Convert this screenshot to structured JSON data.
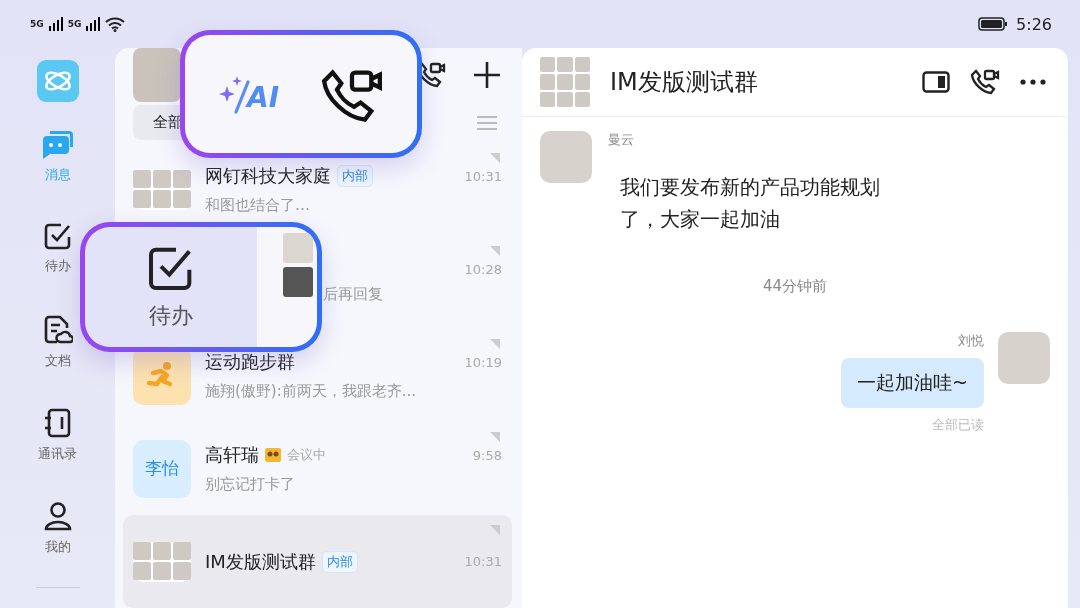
{
  "status_bar": {
    "network_1": "5G",
    "network_2": "5G",
    "time": "5:26"
  },
  "nav": {
    "items": [
      {
        "label": "消息",
        "selected": true
      },
      {
        "label": "待办",
        "selected": false
      },
      {
        "label": "文档",
        "selected": false
      },
      {
        "label": "通讯录",
        "selected": false
      },
      {
        "label": "我的",
        "selected": false
      }
    ]
  },
  "filter": {
    "label": "全部"
  },
  "conversations": [
    {
      "kind": "group",
      "name": "网钉科技大家庭",
      "tag": "内部",
      "time": "10:31",
      "preview": "和图也结合了…",
      "selected": false
    },
    {
      "kind": "covered",
      "time": "10:28",
      "preview": "后再回复",
      "selected": false
    },
    {
      "kind": "runner",
      "name": "运动跑步群",
      "time": "10:19",
      "preview": "施翔(傲野):前两天，我跟老齐...",
      "selected": false
    },
    {
      "kind": "text",
      "avatar_text": "李怡",
      "name": "高轩瑞",
      "status": "会议中",
      "time": "9:58",
      "preview": "别忘记打卡了",
      "selected": false
    },
    {
      "kind": "group",
      "name": "IM发版测试群",
      "tag": "内部",
      "time": "10:31",
      "selected": true
    }
  ],
  "chat": {
    "title": "IM发版测试群",
    "messages": [
      {
        "kind": "incoming",
        "sender": "曼云",
        "text": "我们要发布新的产品功能规划了，大家一起加油"
      },
      {
        "kind": "time",
        "text": "44分钟前"
      },
      {
        "kind": "outgoing",
        "sender": "刘悦",
        "text": "一起加油哇~",
        "receipt": "全部已读"
      }
    ]
  },
  "callouts": {
    "ai_label": "AI",
    "todo_label": "待办"
  }
}
